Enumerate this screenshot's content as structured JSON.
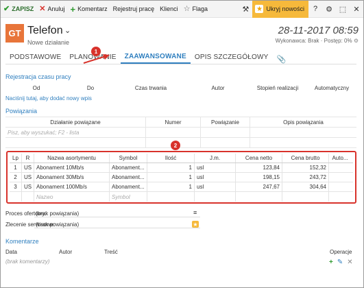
{
  "toolbar": {
    "save": "ZAPISZ",
    "cancel": "Anuluj",
    "comment": "Komentarz",
    "log_work": "Rejestruj pracę",
    "clients": "Klienci",
    "flag": "Flaga",
    "hide_news": "Ukryj nowości",
    "help": "?"
  },
  "header": {
    "badge": "GT",
    "title": "Telefon",
    "subtitle": "Nowe działanie",
    "date": "28-11-2017 08:59",
    "status": "Wykonawca: Brak · Postęp: 0%"
  },
  "tabs": {
    "basic": "PODSTAWOWE",
    "planning": "PLANOWANIE",
    "advanced": "ZAAWANSOWANE",
    "details": "OPIS SZCZEGÓŁOWY"
  },
  "callouts": {
    "one": "1",
    "two": "2"
  },
  "time_log": {
    "title": "Rejestracja czasu pracy",
    "columns": [
      "Od",
      "Do",
      "Czas trwania",
      "Autor",
      "Stopień realizacji",
      "Automatyczny"
    ],
    "add_link": "Naciśnij tutaj, aby dodać nowy wpis"
  },
  "relations": {
    "title": "Powiązania",
    "columns": [
      "Działanie powiązane",
      "Numer",
      "Powiązanie",
      "Opis powiązania"
    ],
    "search_placeholder": "Pisz, aby wyszukać; F2 - lista"
  },
  "items": {
    "columns": [
      "Lp",
      "R",
      "Nazwa asortymentu",
      "Symbol",
      "Ilość",
      "J.m.",
      "Cena netto",
      "Cena brutto",
      "Auto..."
    ],
    "rows": [
      {
        "lp": "1",
        "r": "US",
        "name": "Abonament 10Mb/s",
        "symbol": "Abonament...",
        "qty": "1",
        "unit": "usl",
        "net": "123,84",
        "gross": "152,32"
      },
      {
        "lp": "2",
        "r": "US",
        "name": "Abonament 30Mb/s",
        "symbol": "Abonament...",
        "qty": "1",
        "unit": "usl",
        "net": "198,15",
        "gross": "243,72"
      },
      {
        "lp": "3",
        "r": "US",
        "name": "Abonament 100Mb/s",
        "symbol": "Abonament...",
        "qty": "1",
        "unit": "usl",
        "net": "247,67",
        "gross": "304,64"
      }
    ],
    "new_row": {
      "name": "Nazwo",
      "symbol": "Symbol"
    }
  },
  "fields": {
    "process_label": "Proces ofertowy:",
    "process_value": "(brak powiązania)",
    "service_label": "Zlecenie serwisowe:",
    "service_value": "(brak powiązania)"
  },
  "comments": {
    "title": "Komentarze",
    "col_date": "Data",
    "col_author": "Autor",
    "col_content": "Treść",
    "col_ops": "Operacje",
    "empty": "(brak komentarzy)"
  }
}
